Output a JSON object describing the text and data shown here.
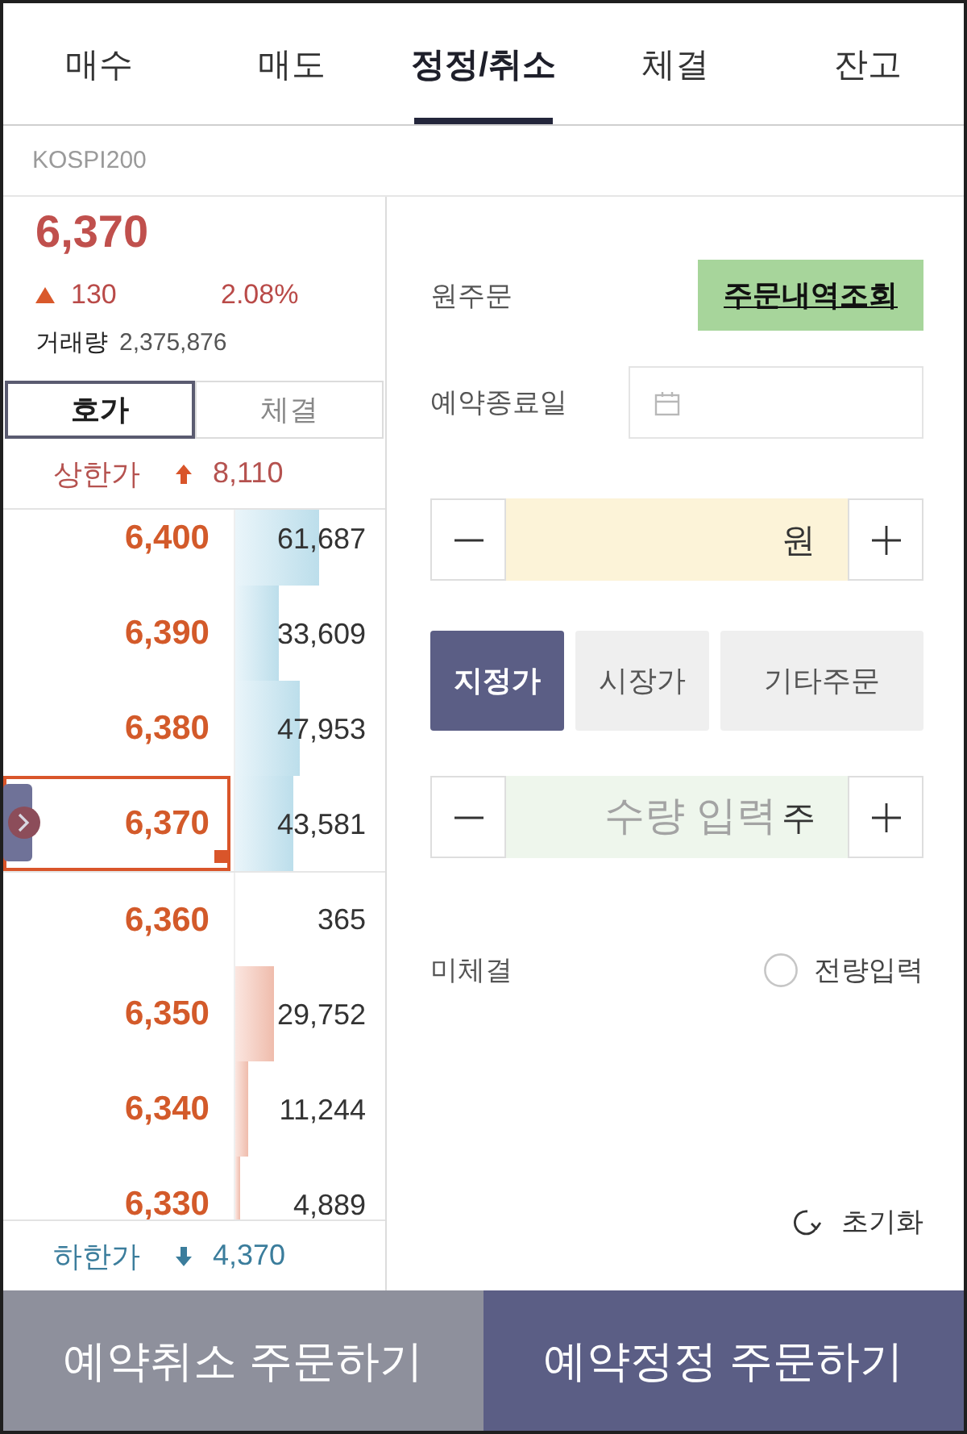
{
  "tabs": [
    {
      "label": "매수",
      "selected": false
    },
    {
      "label": "매도",
      "selected": false
    },
    {
      "label": "정정/취소",
      "selected": true
    },
    {
      "label": "체결",
      "selected": false
    },
    {
      "label": "잔고",
      "selected": false
    }
  ],
  "instrument": {
    "name": "KOSPI200"
  },
  "quote": {
    "price": "6,370",
    "change": "130",
    "change_rate": "2.08%",
    "volume_label": "거래량",
    "volume": "2,375,876"
  },
  "book_tabs": [
    {
      "label": "호가",
      "selected": true
    },
    {
      "label": "체결",
      "selected": false
    }
  ],
  "upper_limit": {
    "label": "상한가",
    "price": "8,110"
  },
  "order_book": [
    {
      "kind": "ask",
      "price": "6,400",
      "quantity": "61,687",
      "level": 0.56,
      "selected": false
    },
    {
      "kind": "ask",
      "price": "6,390",
      "quantity": "33,609",
      "level": 0.29,
      "selected": false
    },
    {
      "kind": "ask",
      "price": "6,380",
      "quantity": "47,953",
      "level": 0.43,
      "selected": false
    },
    {
      "kind": "ask",
      "price": "6,370",
      "quantity": "43,581",
      "level": 0.39,
      "selected": true
    },
    {
      "kind": "bid",
      "price": "6,360",
      "quantity": "365",
      "selected": false
    },
    {
      "kind": "bid",
      "price": "6,350",
      "quantity": "29,752",
      "level": 0.26,
      "selected": false
    },
    {
      "kind": "bid",
      "price": "6,340",
      "quantity": "11,244",
      "level": 0.09,
      "selected": false
    },
    {
      "kind": "bid",
      "price": "6,330",
      "quantity": "4,889",
      "level": 0.03,
      "selected": false
    }
  ],
  "lower_limit": {
    "label": "하한가",
    "price": "4,370"
  },
  "order_form": {
    "original_order": {
      "label": "원주문",
      "button": "주문내역조회"
    },
    "end_date": {
      "label": "예약종료일"
    },
    "price": {
      "unit": "원"
    },
    "order_types": [
      {
        "label": "지정가",
        "selected": true
      },
      {
        "label": "시장가",
        "selected": false
      },
      {
        "label": "기타주문",
        "selected": false
      }
    ],
    "quantity": {
      "placeholder": "수량 입력",
      "unit": "주"
    },
    "unfilled": {
      "label": "미체결",
      "option": "전량입력",
      "checked": false
    },
    "reset": "초기화"
  },
  "actions": [
    {
      "label": "예약취소 주문하기",
      "kind": "secondary"
    },
    {
      "label": "예약정정 주문하기",
      "kind": "primary"
    }
  ]
}
